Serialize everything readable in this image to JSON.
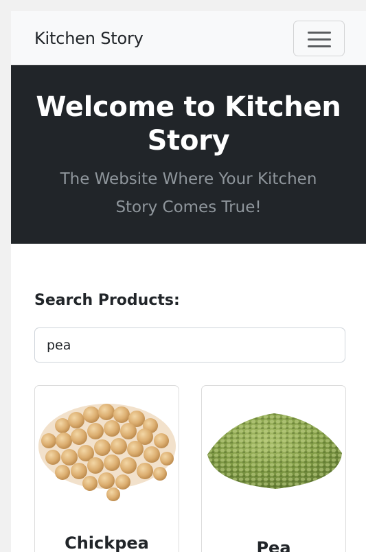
{
  "navbar": {
    "brand": "Kitchen Story",
    "toggler_icon": "hamburger-menu-icon"
  },
  "hero": {
    "title": "Welcome to Kitchen Story",
    "subtitle": "The Website Where Your Kitchen Story Comes True!"
  },
  "search": {
    "label": "Search Products:",
    "value": "pea"
  },
  "products": [
    {
      "name": "Chickpea",
      "image": "chickpea-image"
    },
    {
      "name": "Pea",
      "image": "split-pea-image"
    }
  ],
  "colors": {
    "hero_bg": "#212529",
    "navbar_bg": "#f8f9fa",
    "subtitle": "#8f969c"
  }
}
